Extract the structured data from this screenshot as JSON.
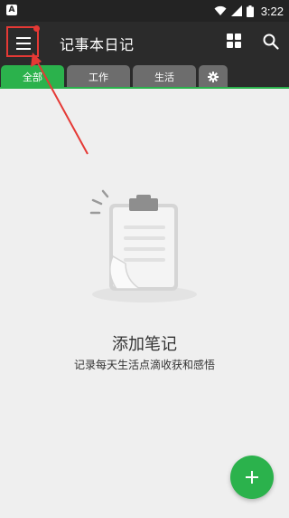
{
  "status_bar": {
    "time": "3:22",
    "left_icon_letter": "A",
    "icons": [
      "wifi-icon",
      "signal-icon",
      "battery-icon"
    ]
  },
  "app_bar": {
    "title": "记事本日记",
    "icons": [
      "menu-icon",
      "grid-view-icon",
      "search-icon"
    ]
  },
  "tabs": [
    {
      "label": "全部",
      "active": true
    },
    {
      "label": "工作",
      "active": false
    },
    {
      "label": "生活",
      "active": false
    },
    {
      "label": "",
      "icon": "settings-gear-icon",
      "active": false
    }
  ],
  "empty_state": {
    "icon": "clipboard-icon",
    "title": "添加笔记",
    "subtitle": "记录每天生活点滴收获和感悟"
  },
  "fab": {
    "icon": "plus-icon"
  },
  "colors": {
    "accent": "#2bb24c",
    "toolbar": "#2b2b2b",
    "tab_inactive": "#6d6d6d",
    "background": "#efefef",
    "annotation_red": "#e53935"
  }
}
